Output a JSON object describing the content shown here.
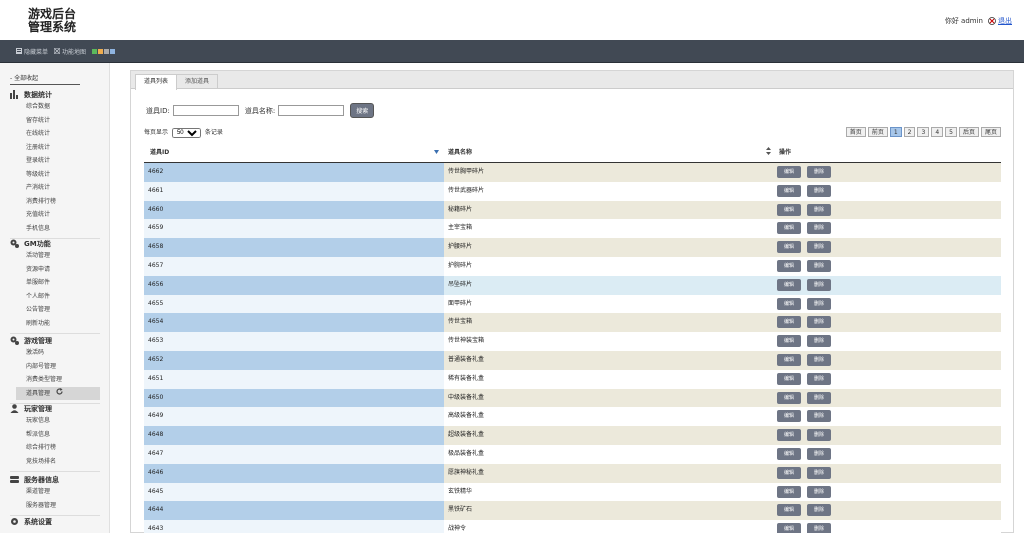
{
  "header": {
    "logo_line1": "游戏后台",
    "logo_line2": "管理系统",
    "greeting": "你好 admin",
    "logout": "退出"
  },
  "toolbar": {
    "hide_menu": "隐藏菜单",
    "func_map": "功能地图",
    "themes": [
      "#5cb85c",
      "#f0ad4e",
      "#aaaaaa",
      "#8fb4e0"
    ]
  },
  "sidebar": {
    "all": "- 全部收起",
    "groups": [
      {
        "title": "数据统计",
        "icon": "bar-chart-icon",
        "items": [
          "综合数据",
          "留存统计",
          "在线统计",
          "注册统计",
          "登录统计",
          "等级统计",
          "产消统计",
          "消费排行榜",
          "充值统计",
          "手机信息"
        ]
      },
      {
        "title": "GM功能",
        "icon": "gears-icon",
        "items": [
          "活动管理",
          "资源申请",
          "单服邮件",
          "个人邮件",
          "公告管理",
          "刷新功能"
        ]
      },
      {
        "title": "游戏管理",
        "icon": "gears-icon",
        "items": [
          "激活码",
          "内部号管理",
          "消费类型管理",
          "道具管理"
        ]
      },
      {
        "title": "玩家管理",
        "icon": "user-icon",
        "items": [
          "玩家信息",
          "帮派信息",
          "综合排行榜",
          "竞技场排名"
        ]
      },
      {
        "title": "服务器信息",
        "icon": "server-icon",
        "items": [
          "渠道管理",
          "服务器管理"
        ]
      },
      {
        "title": "系统设置",
        "icon": "gear-icon",
        "items": []
      }
    ]
  },
  "tabs": [
    "道具列表",
    "添加道具"
  ],
  "search": {
    "id_label": "道具ID:",
    "name_label": "道具名称:",
    "button": "搜索"
  },
  "grid": {
    "per_page_pre": "每页显示",
    "per_page_val": "50",
    "per_page_post": "条记录",
    "pager": [
      "首页",
      "前页",
      "1",
      "2",
      "3",
      "4",
      "5",
      "后页",
      "尾页"
    ],
    "cols": [
      "道具ID",
      "道具名称",
      "操作"
    ],
    "edit": "编辑",
    "del": "删除",
    "rows": [
      {
        "id": "4662",
        "name": "传世胸甲碎片"
      },
      {
        "id": "4661",
        "name": "传世武器碎片"
      },
      {
        "id": "4660",
        "name": "秘籍碎片"
      },
      {
        "id": "4659",
        "name": "主宰宝箱"
      },
      {
        "id": "4658",
        "name": "护腰碎片"
      },
      {
        "id": "4657",
        "name": "护腕碎片"
      },
      {
        "id": "4656",
        "name": "吊坠碎片"
      },
      {
        "id": "4655",
        "name": "面甲碎片"
      },
      {
        "id": "4654",
        "name": "传世宝箱"
      },
      {
        "id": "4653",
        "name": "传世神装宝箱"
      },
      {
        "id": "4652",
        "name": "普通装备礼盒"
      },
      {
        "id": "4651",
        "name": "稀有装备礼盒"
      },
      {
        "id": "4650",
        "name": "中级装备礼盒"
      },
      {
        "id": "4649",
        "name": "高级装备礼盒"
      },
      {
        "id": "4648",
        "name": "超级装备礼盒"
      },
      {
        "id": "4647",
        "name": "极品装备礼盒"
      },
      {
        "id": "4646",
        "name": "愿旗神秘礼盒"
      },
      {
        "id": "4645",
        "name": "玄铁精华"
      },
      {
        "id": "4644",
        "name": "黑铁矿石"
      },
      {
        "id": "4643",
        "name": "战神令"
      }
    ]
  }
}
